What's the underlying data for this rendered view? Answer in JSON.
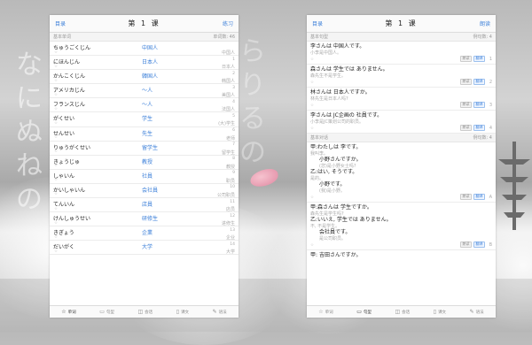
{
  "left": {
    "nav": {
      "back": "目录",
      "title": "第 1 课",
      "action": "练习"
    },
    "section": {
      "label": "基本单词",
      "count": "单词数: 46"
    },
    "words": [
      {
        "kana": "ちゅうごくじん",
        "kanji": "中国人",
        "num": "",
        "meaning": "中国人"
      },
      {
        "kana": "にほんじん",
        "kanji": "日本人",
        "num": "1",
        "meaning": "日本人"
      },
      {
        "kana": "かんこくじん",
        "kanji": "韓国人",
        "num": "2",
        "meaning": "韩国人"
      },
      {
        "kana": "アメリカじん",
        "kanji": "～人",
        "num": "3",
        "meaning": "美国人"
      },
      {
        "kana": "フランスじん",
        "kanji": "～人",
        "num": "4",
        "meaning": "法国人"
      },
      {
        "kana": "がくせい",
        "kanji": "学生",
        "num": "5",
        "meaning": "(大)学生"
      },
      {
        "kana": "せんせい",
        "kanji": "先生",
        "num": "6",
        "meaning": "老师"
      },
      {
        "kana": "りゅうがくせい",
        "kanji": "留学生",
        "num": "7",
        "meaning": "留学生"
      },
      {
        "kana": "きょうじゅ",
        "kanji": "教授",
        "num": "8",
        "meaning": "教授"
      },
      {
        "kana": "しゃいん",
        "kanji": "社員",
        "num": "9",
        "meaning": "职员"
      },
      {
        "kana": "かいしゃいん",
        "kanji": "会社員",
        "num": "10",
        "meaning": "公司职员"
      },
      {
        "kana": "てんいん",
        "kanji": "店員",
        "num": "11",
        "meaning": "店员"
      },
      {
        "kana": "けんしゅうせい",
        "kanji": "研修生",
        "num": "12",
        "meaning": "进修生"
      },
      {
        "kana": "きぎょう",
        "kanji": "企業",
        "num": "13",
        "meaning": "企业"
      },
      {
        "kana": "だいがく",
        "kanji": "大学",
        "num": "14",
        "meaning": "大学"
      }
    ],
    "tabs": [
      {
        "icon": "☆",
        "label": "单词",
        "active": true
      },
      {
        "icon": "▭",
        "label": "句型",
        "active": false
      },
      {
        "icon": "◫",
        "label": "会话",
        "active": false
      },
      {
        "icon": "▯",
        "label": "课文",
        "active": false
      },
      {
        "icon": "✎",
        "label": "语法",
        "active": false
      }
    ]
  },
  "right": {
    "nav": {
      "back": "目录",
      "title": "第 1 课",
      "action": "朗读"
    },
    "section1": {
      "label": "基本句型",
      "count": "例句数: 4"
    },
    "sentences": [
      {
        "jp": "李さんは 中国人です。",
        "cn": "小李是中国人。",
        "num": "1"
      },
      {
        "jp": "森さんは 学生では ありません。",
        "cn": "森先生不是学生。",
        "num": "2"
      },
      {
        "jp": "林さんは 日本人ですか。",
        "cn": "林先生是日本人吗?",
        "num": "3"
      },
      {
        "jp": "李さんは JC企画の 社員です。",
        "cn": "小李是JC策划公司的职员。",
        "num": "4"
      }
    ],
    "section2": {
      "label": "基本对话",
      "count": "例句数: 4"
    },
    "dialogA": {
      "lines": [
        {
          "speaker": "甲:",
          "jp": "わたしは 李です。",
          "cn": "我叫李。",
          "indent": false
        },
        {
          "speaker": "",
          "jp": "小野さんですか。",
          "cn": "(您)是小野女士吗?",
          "indent": true
        },
        {
          "speaker": "乙:",
          "jp": "はい, そうです。",
          "cn": "是的。",
          "indent": false
        },
        {
          "speaker": "",
          "jp": "小野です。",
          "cn": "(我)是小野。",
          "indent": true
        }
      ],
      "num": "A"
    },
    "dialogB": {
      "lines": [
        {
          "speaker": "甲:",
          "jp": "森さんは 学生ですか。",
          "cn": "森先生是学生吗?",
          "indent": false
        },
        {
          "speaker": "乙:",
          "jp": "いいえ, 学生では ありません。",
          "cn": "不, 不是学生。",
          "indent": false
        },
        {
          "speaker": "",
          "jp": "会社員です。",
          "cn": "是公司职员。",
          "indent": true
        }
      ],
      "num": "B"
    },
    "dialogC": {
      "speaker": "甲:",
      "jp": "吉田さんですか。"
    },
    "pill_audio": "朗读",
    "pill_translate": "翻译",
    "tabs": [
      {
        "icon": "☆",
        "label": "单词",
        "active": false
      },
      {
        "icon": "▭",
        "label": "句型",
        "active": true
      },
      {
        "icon": "◫",
        "label": "会话",
        "active": false
      },
      {
        "icon": "▯",
        "label": "课文",
        "active": false
      },
      {
        "icon": "✎",
        "label": "语法",
        "active": false
      }
    ]
  },
  "background_text": {
    "left": "なにぬねの",
    "center": "らりるの"
  },
  "colors": {
    "accent": "#3b7fd9",
    "petal": "#e79bb0"
  }
}
